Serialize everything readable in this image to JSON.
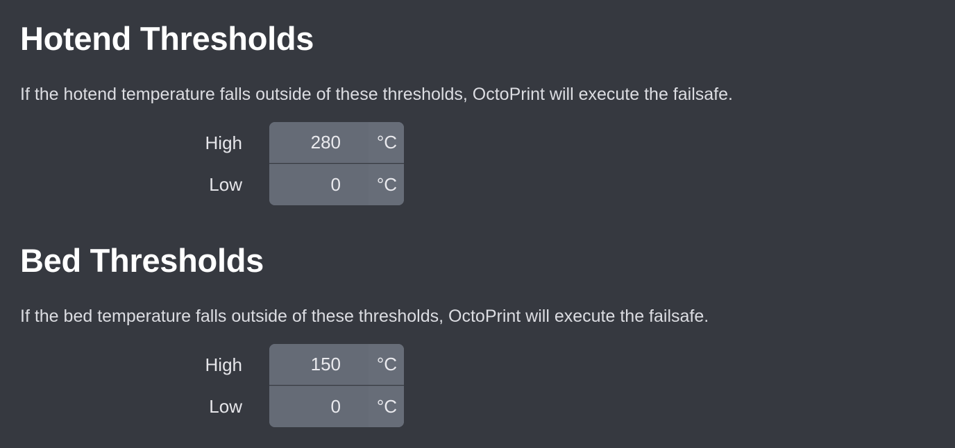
{
  "sections": [
    {
      "title": "Hotend Thresholds",
      "description": "If the hotend temperature falls outside of these thresholds, OctoPrint will execute the failsafe.",
      "fields": [
        {
          "label": "High",
          "value": "280",
          "unit": "°C"
        },
        {
          "label": "Low",
          "value": "0",
          "unit": "°C"
        }
      ]
    },
    {
      "title": "Bed Thresholds",
      "description": "If the bed temperature falls outside of these thresholds, OctoPrint will execute the failsafe.",
      "fields": [
        {
          "label": "High",
          "value": "150",
          "unit": "°C"
        },
        {
          "label": "Low",
          "value": "0",
          "unit": "°C"
        }
      ]
    }
  ]
}
